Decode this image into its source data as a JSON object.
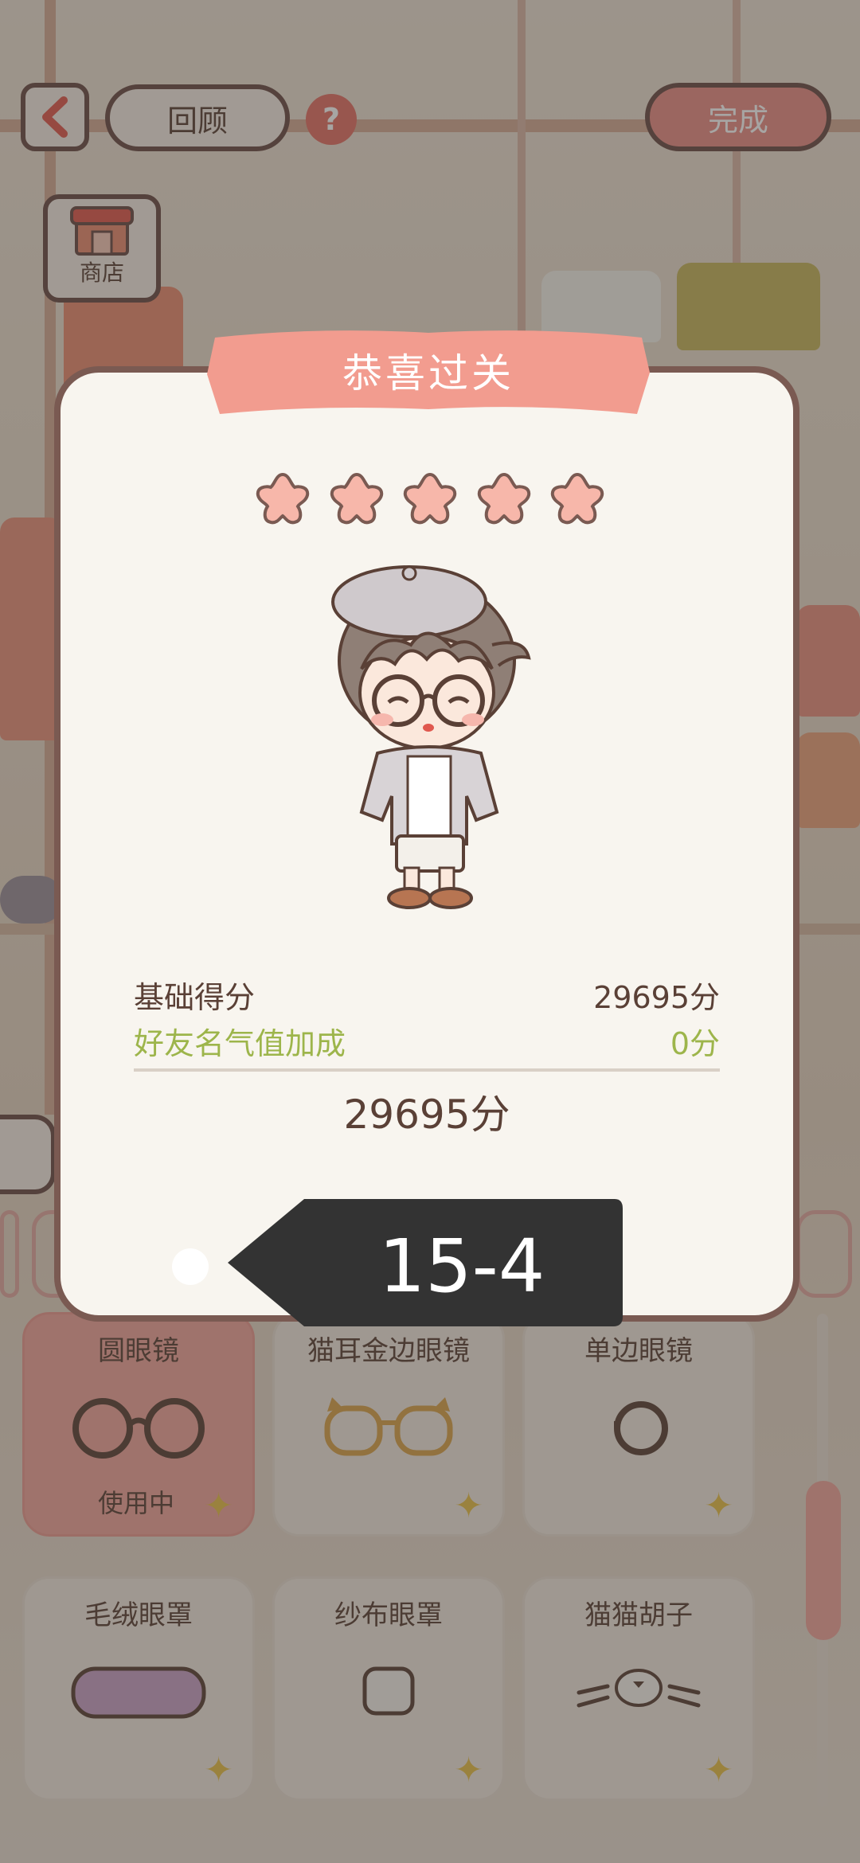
{
  "top_bar": {
    "back_icon": "chevron-left-icon",
    "review_label": "回顾",
    "help_label": "?",
    "finish_label": "完成"
  },
  "shop": {
    "label": "商店",
    "icon": "shop-icon"
  },
  "items": [
    {
      "name": "圆眼镜",
      "status": "使用中",
      "active": true
    },
    {
      "name": "猫耳金边眼镜",
      "status": "",
      "active": false
    },
    {
      "name": "单边眼镜",
      "status": "",
      "active": false
    },
    {
      "name": "毛绒眼罩",
      "status": "",
      "active": false
    },
    {
      "name": "纱布眼罩",
      "status": "",
      "active": false
    },
    {
      "name": "猫猫胡子",
      "status": "",
      "active": false
    }
  ],
  "result": {
    "title": "恭喜过关",
    "stars": 5,
    "base_label": "基础得分",
    "base_value": "29695分",
    "bonus_label": "好友名气值加成",
    "bonus_value": "0分",
    "total": "29695分",
    "level": "15-4"
  },
  "colors": {
    "accent_pink": "#f0a49b",
    "bonus_green": "#9db54b",
    "border_brown": "#7a5a52",
    "level_tag": "#333333"
  }
}
